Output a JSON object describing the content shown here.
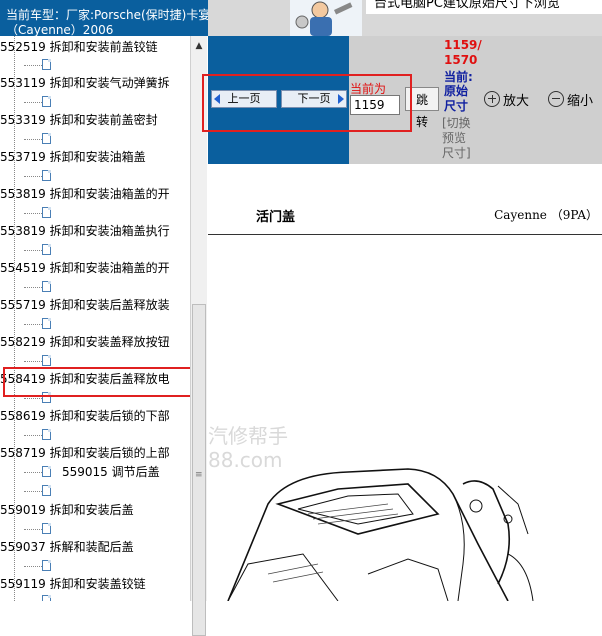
{
  "banner": {
    "car_info_label": "当前车型：",
    "car_info_value": "厂家:Porsche(保时捷)卡宴",
    "car_info_line2": "（Cayenne）2006",
    "message": "台式电脑PC建议原始尺寸下浏览"
  },
  "tree": {
    "items": [
      {
        "code": "552519",
        "label": "拆卸和安装前盖铰链"
      },
      {
        "code": "553119",
        "label": "拆卸和安装气动弹簧拆"
      },
      {
        "code": "553319",
        "label": "拆卸和安装前盖密封"
      },
      {
        "code": "553719",
        "label": "拆卸和安装油箱盖"
      },
      {
        "code": "553819",
        "label": "拆卸和安装油箱盖的开"
      },
      {
        "code": "553819",
        "label": "拆卸和安装油箱盖执行"
      },
      {
        "code": "554519",
        "label": "拆卸和安装油箱盖的开"
      },
      {
        "code": "555719",
        "label": "拆卸和安装后盖释放装"
      },
      {
        "code": "558219",
        "label": "拆卸和安装盖释放按钮"
      },
      {
        "code": "558419",
        "label": "拆卸和安装后盖释放电"
      },
      {
        "code": "558619",
        "label": "拆卸和安装后锁的下部"
      },
      {
        "code": "558719",
        "label": "拆卸和安装后锁的上部"
      },
      {
        "code": "559015",
        "label": "调节后盖"
      },
      {
        "code": "559019",
        "label": "拆卸和安装后盖"
      },
      {
        "code": "559037",
        "label": "拆解和装配后盖"
      },
      {
        "code": "559119",
        "label": "拆卸和安装盖铰链"
      }
    ]
  },
  "toolbar": {
    "prev_label": "上一页",
    "next_label": "下一页",
    "current_label": "当前为",
    "page_value": "1159",
    "jump_label": "跳转",
    "page_count_line1": "1159/",
    "page_count_line2": "1570",
    "current_short": "当前:",
    "original_size": "原始尺寸",
    "toggle_size": "[切换预览尺寸]",
    "zoom_in": "放大",
    "zoom_out": "缩小"
  },
  "document": {
    "title": "活门盖",
    "model": "Cayenne （9PA）",
    "watermark_1": "汽修帮手",
    "watermark_2": "88.com"
  },
  "colors": {
    "banner_blue": "#0a5f9e",
    "highlight_red": "#e02020",
    "page_count_red": "#e01010",
    "size_label_blue": "#1020a0"
  }
}
